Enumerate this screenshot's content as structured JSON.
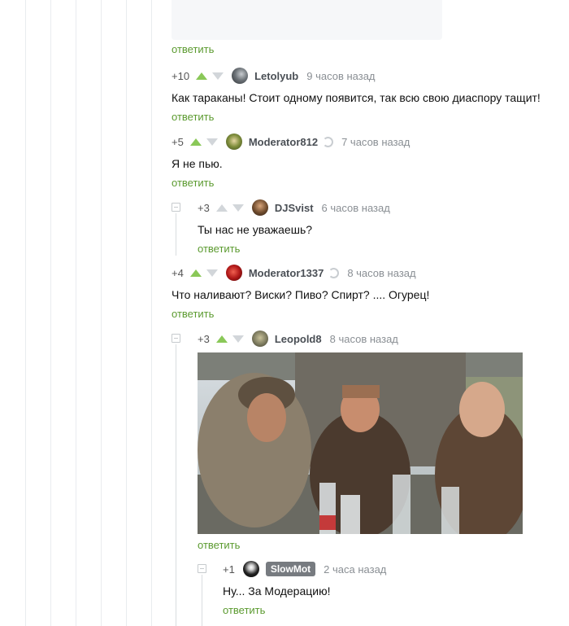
{
  "comments": [
    {
      "rating": "",
      "author": "",
      "time": "",
      "text": "",
      "reply": "ответить"
    },
    {
      "rating": "+10",
      "author": "Letolyub",
      "time": "9 часов назад",
      "text": "Как тараканы! Стоит одному появится, так всю свою диаспору тащит!",
      "reply": "ответить"
    },
    {
      "rating": "+5",
      "author": "Moderator812",
      "time": "7 часов назад",
      "text": "Я не пью.",
      "reply": "ответить"
    },
    {
      "rating": "+3",
      "author": "DJSvist",
      "time": "6 часов назад",
      "text": "Ты нас не уважаешь?",
      "reply": "ответить"
    },
    {
      "rating": "+4",
      "author": "Moderator1337",
      "time": "8 часов назад",
      "text": "Что наливают? Виски? Пиво? Спирт? .... Огурец!",
      "reply": "ответить"
    },
    {
      "rating": "+3",
      "author": "Leopold8",
      "time": "8 часов назад",
      "text": "",
      "reply": "ответить"
    },
    {
      "rating": "+1",
      "author": "SlowMot",
      "time": "2 часа назад",
      "text": "Ну... За Модерацию!",
      "reply": "ответить"
    }
  ],
  "colors": {
    "upvote": "#8ac858",
    "reply": "#5b9a2f",
    "neutral": "#d2d6da"
  },
  "icons": {
    "collapse": "minus-square-icon",
    "moderator": "moderator-badge-icon",
    "up": "arrow-up-icon",
    "down": "arrow-down-icon"
  }
}
